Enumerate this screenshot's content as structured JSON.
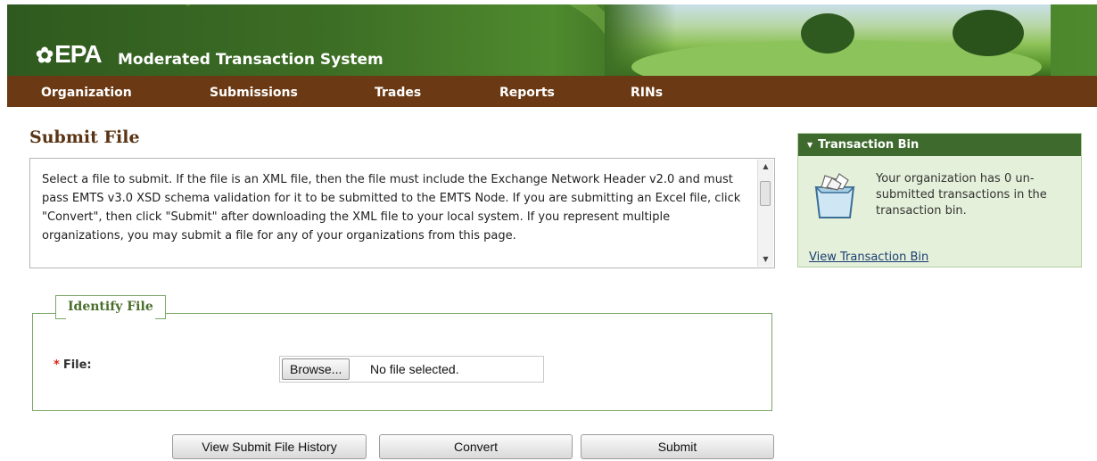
{
  "header": {
    "logo_text": "EPA",
    "app_title": "Moderated Transaction System",
    "colors": {
      "banner_green": "#3d6e25",
      "nav_brown": "#6b3a14"
    }
  },
  "nav": {
    "items": [
      {
        "label": "Organization"
      },
      {
        "label": "Submissions"
      },
      {
        "label": "Trades"
      },
      {
        "label": "Reports"
      },
      {
        "label": "RINs"
      }
    ]
  },
  "page": {
    "title": "Submit File",
    "instructions": "Select a file to submit. If the file is an XML file, then the file must include the Exchange Network Header v2.0 and must pass EMTS v3.0 XSD schema validation for it to be submitted to the EMTS Node. If you are submitting an Excel file, click \"Convert\", then click \"Submit\" after downloading the XML file to your local system. If you represent multiple organizations, you may submit a file for any of your organizations from this page."
  },
  "identify_file": {
    "legend": "Identify File",
    "required_marker": "*",
    "file_label": "File:",
    "browse_label": "Browse...",
    "file_status": "No file selected."
  },
  "buttons": {
    "history": "View Submit File History",
    "convert": "Convert",
    "submit": "Submit"
  },
  "transaction_bin": {
    "title": "Transaction Bin",
    "message": "Your organization has 0 un-submitted transactions in the transaction bin.",
    "link": "View Transaction Bin",
    "icon": "file-box-icon"
  }
}
